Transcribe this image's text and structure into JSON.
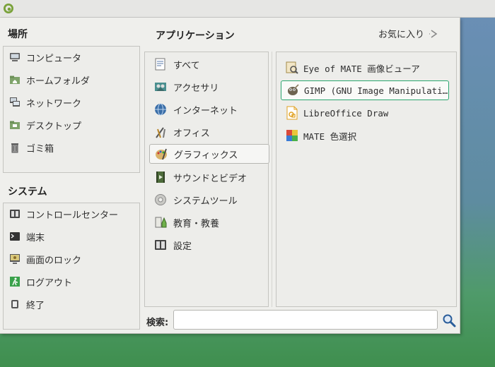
{
  "places": {
    "heading": "場所",
    "items": [
      {
        "label": "コンピュータ",
        "icon": "computer-icon"
      },
      {
        "label": "ホームフォルダ",
        "icon": "home-folder-icon"
      },
      {
        "label": "ネットワーク",
        "icon": "network-icon"
      },
      {
        "label": "デスクトップ",
        "icon": "desktop-folder-icon"
      },
      {
        "label": "ゴミ箱",
        "icon": "trash-icon"
      }
    ]
  },
  "system": {
    "heading": "システム",
    "items": [
      {
        "label": "コントロールセンター",
        "icon": "control-center-icon"
      },
      {
        "label": "端末",
        "icon": "terminal-icon"
      },
      {
        "label": "画面のロック",
        "icon": "lock-screen-icon"
      },
      {
        "label": "ログアウト",
        "icon": "logout-icon"
      },
      {
        "label": "終了",
        "icon": "shutdown-icon"
      }
    ]
  },
  "applications": {
    "heading": "アプリケーション",
    "favorites_label": "お気に入り",
    "selected_category": "グラフィックス",
    "categories": [
      {
        "label": "すべて",
        "icon": "all-apps-icon"
      },
      {
        "label": "アクセサリ",
        "icon": "accessories-icon"
      },
      {
        "label": "インターネット",
        "icon": "internet-icon"
      },
      {
        "label": "オフィス",
        "icon": "office-icon"
      },
      {
        "label": "グラフィックス",
        "icon": "graphics-icon"
      },
      {
        "label": "サウンドとビデオ",
        "icon": "sound-video-icon"
      },
      {
        "label": "システムツール",
        "icon": "system-tools-icon"
      },
      {
        "label": "教育・教養",
        "icon": "education-icon"
      },
      {
        "label": "設定",
        "icon": "settings-icon"
      }
    ],
    "apps": [
      {
        "label": "Eye of MATE 画像ビューア",
        "icon": "image-viewer-icon"
      },
      {
        "label": "GIMP (GNU Image Manipulation Program)",
        "icon": "gimp-icon"
      },
      {
        "label": "LibreOffice Draw",
        "icon": "libreoffice-draw-icon"
      },
      {
        "label": "MATE 色選択",
        "icon": "color-picker-icon"
      }
    ]
  },
  "search": {
    "label": "検索:",
    "value": "",
    "placeholder": ""
  },
  "colors": {
    "focus_border": "#2aa56e",
    "menu_background": "#efefec"
  }
}
